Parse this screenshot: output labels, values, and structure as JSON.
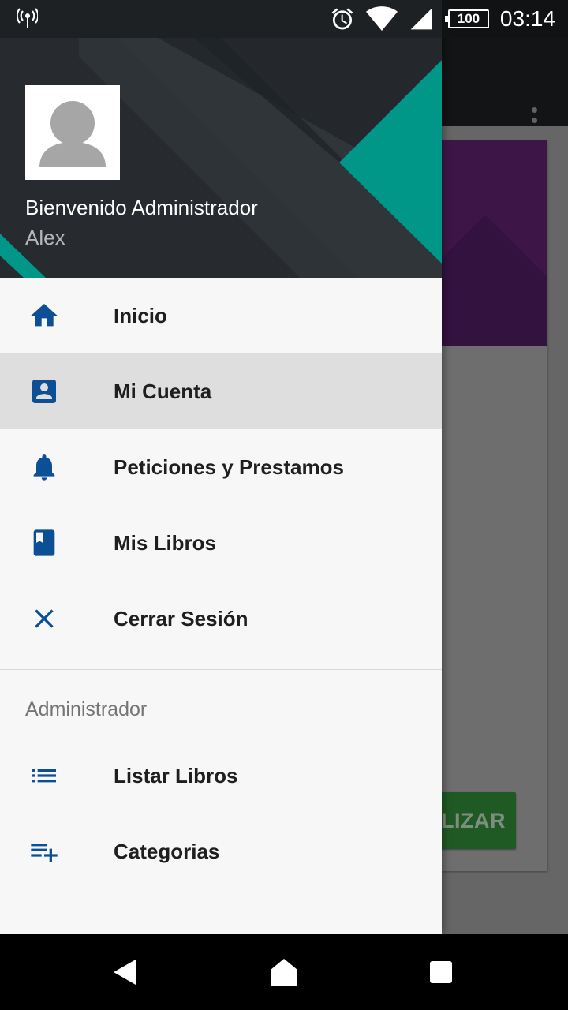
{
  "status_bar": {
    "time": "03:14",
    "battery": "100",
    "icons": [
      "hotspot-icon",
      "alarm-icon",
      "wifi-icon",
      "signal-icon",
      "battery-icon"
    ]
  },
  "background_app": {
    "button_label": "LIZAR",
    "overflow_icon": "more-vert-icon"
  },
  "drawer": {
    "header": {
      "title": "Bienvenido  Administrador",
      "subtitle": "Alex",
      "avatar_icon": "person-icon",
      "accent_color": "#009688",
      "header_color": "#272b30"
    },
    "items": [
      {
        "label": "Inicio",
        "icon": "home-icon",
        "active": false
      },
      {
        "label": "Mi Cuenta",
        "icon": "account-box-icon",
        "active": true
      },
      {
        "label": "Peticiones y Prestamos",
        "icon": "bell-icon",
        "active": false
      },
      {
        "label": "Mis Libros",
        "icon": "book-icon",
        "active": false
      },
      {
        "label": "Cerrar Sesión",
        "icon": "close-icon",
        "active": false
      }
    ],
    "admin_section": {
      "title": "Administrador",
      "items": [
        {
          "label": "Listar Libros",
          "icon": "list-icon"
        },
        {
          "label": "Categorias",
          "icon": "playlist-add-icon"
        }
      ]
    },
    "icon_color": "#0d4f94",
    "active_bg": "#dedede"
  },
  "nav_bar": {
    "buttons": [
      "back-icon",
      "home-nav-icon",
      "recents-icon"
    ]
  }
}
